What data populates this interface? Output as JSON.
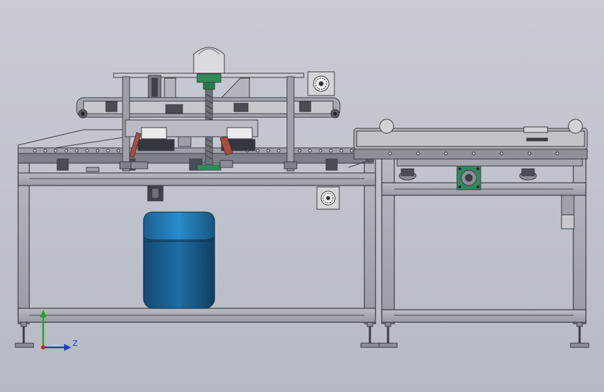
{
  "viewport": {
    "background_top": "#c9ccd3",
    "background_bottom": "#b6bac3",
    "model_colors": {
      "frame": "#a7aab2",
      "frame_edge": "#3a3c42",
      "steel_dark": "#5a5d64",
      "tank_blue": "#1b6fa8",
      "tank_blue_light": "#2a8ccc",
      "motor_green": "#2f8c5a",
      "accent_red": "#b04a3a"
    }
  },
  "triad": {
    "x_axis_color": "#1b3bd6",
    "y_axis_color": "#26a52a",
    "z_label": "Z",
    "origin_color": "#d12020"
  }
}
